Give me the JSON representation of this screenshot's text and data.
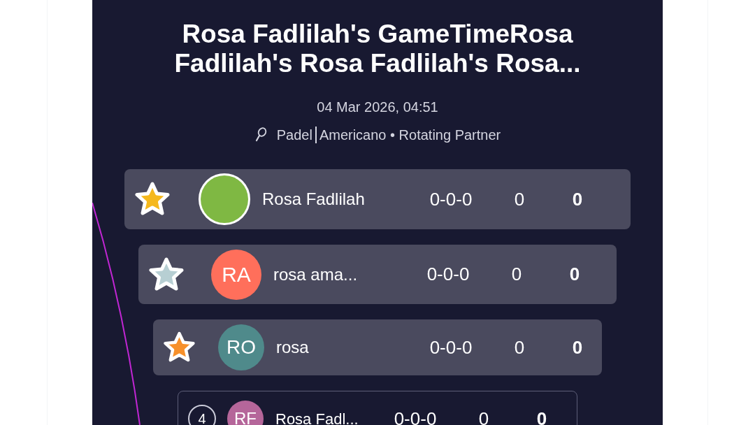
{
  "title": "Rosa Fadlilah's GameTimeRosa Fadlilah's Rosa Fadlilah's Rosa...",
  "datetime": "04 Mar 2026, 04:51",
  "sport": "Padel",
  "format": "Americano • Rotating Partner",
  "standings": [
    {
      "kind": "medal",
      "color": "#f5b81c",
      "avatar": {
        "kind": "photo"
      },
      "name": "Rosa Fadlilah",
      "record": "0-0-0",
      "column_4": "0",
      "points": "0"
    },
    {
      "kind": "medal",
      "color": "#b7cfd3",
      "avatar": {
        "kind": "initials",
        "text": "RA",
        "color": "#ff6f5b"
      },
      "name": "rosa ama...",
      "record": "0-0-0",
      "column_4": "0",
      "points": "0"
    },
    {
      "kind": "medal",
      "color": "#f7902a",
      "avatar": {
        "kind": "initials",
        "text": "RO",
        "color": "#4f8a8b"
      },
      "name": "rosa",
      "record": "0-0-0",
      "column_4": "0",
      "points": "0"
    },
    {
      "kind": "rank",
      "rank": "4",
      "avatar": {
        "kind": "initials",
        "text": "RF",
        "color": "#b5669a"
      },
      "name": "Rosa Fadl...",
      "record": "0-0-0",
      "column_4": "0",
      "points": "0"
    }
  ]
}
